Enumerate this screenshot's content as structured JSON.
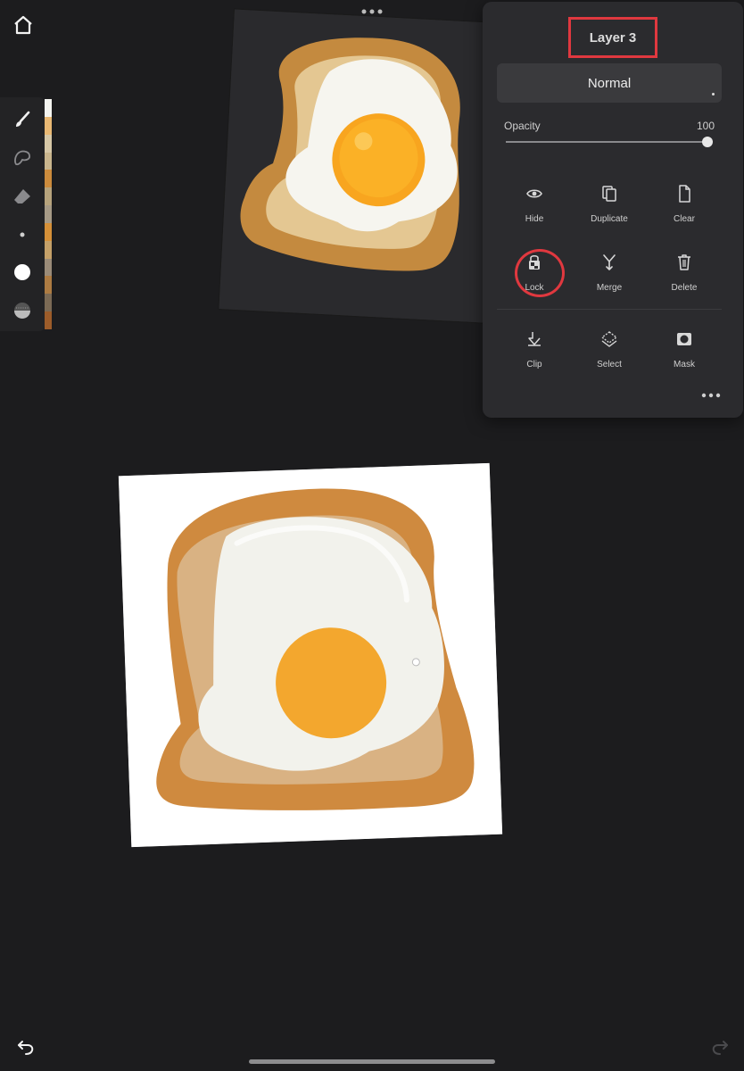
{
  "panel": {
    "layer_name": "Layer 3",
    "blend_mode": "Normal",
    "opacity_label": "Opacity",
    "opacity_value": "100",
    "opacity_level": 1.0,
    "actions": [
      {
        "label": "Hide",
        "icon": "eye-icon"
      },
      {
        "label": "Duplicate",
        "icon": "duplicate-icon"
      },
      {
        "label": "Clear",
        "icon": "clear-icon"
      },
      {
        "label": "Lock",
        "icon": "lock-icon"
      },
      {
        "label": "Merge",
        "icon": "merge-icon"
      },
      {
        "label": "Delete",
        "icon": "trash-icon"
      },
      {
        "label": "Clip",
        "icon": "clip-icon"
      },
      {
        "label": "Select",
        "icon": "select-icon"
      },
      {
        "label": "Mask",
        "icon": "mask-icon"
      }
    ],
    "highlight_color": "#e0383f"
  },
  "toolbar": {
    "tools": [
      "brush-icon",
      "lasso-icon",
      "eraser-icon",
      "brush-size-icon",
      "color-icon",
      "opacity-dither-icon"
    ],
    "swatch_colors": [
      "#f4f4f0",
      "#e9b873",
      "#d6c7a6",
      "#c9b58d",
      "#cc8b3c",
      "#b6a37c",
      "#a69a86",
      "#d59038",
      "#c4a068",
      "#9a8b78",
      "#ad7b42",
      "#7b6a55",
      "#9c5c2a"
    ]
  },
  "colors": {
    "background": "#1c1c1e",
    "panel": "#2b2b2e",
    "accent_red": "#e0383f"
  }
}
